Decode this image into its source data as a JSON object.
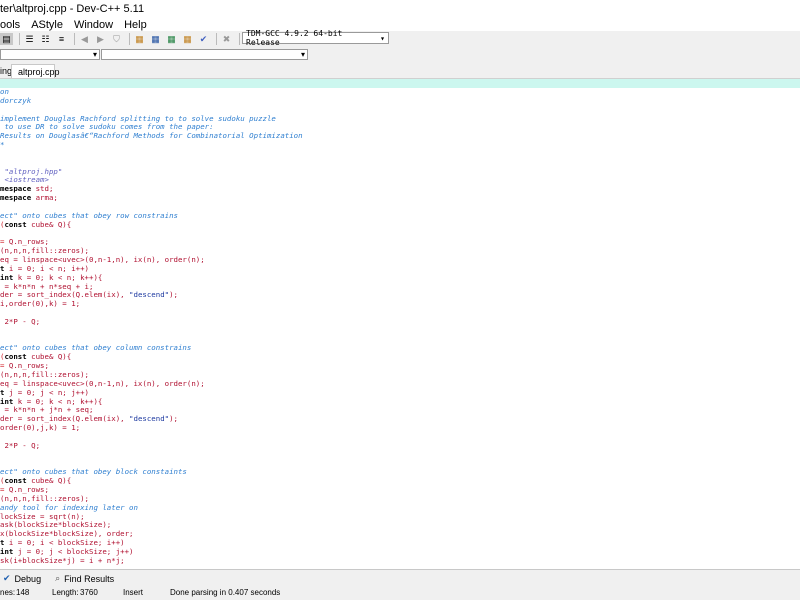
{
  "window": {
    "title": "ter\\altproj.cpp - Dev-C++ 5.11"
  },
  "menu": [
    "ools",
    "AStyle",
    "Window",
    "Help"
  ],
  "toolbar": {
    "compiler": "TDM-GCC 4.9.2 64-bit Release"
  },
  "tabs": [
    {
      "label": "ing"
    },
    {
      "label": "altproj.cpp"
    }
  ],
  "editor": {
    "lines": [
      [
        [
          "c",
          "on"
        ]
      ],
      [
        [
          "c",
          "dorczyk"
        ]
      ],
      [],
      [
        [
          "c",
          "implement Douglas Rachford splitting to to solve sudoku puzzle"
        ]
      ],
      [
        [
          "c",
          " to use DR to solve sudoku comes from the paper:"
        ]
      ],
      [
        [
          "c",
          "Results on Douglasâ€“Rachford Methods for Combinatorial Optimization"
        ]
      ],
      [
        [
          "c",
          "*"
        ]
      ],
      [],
      [],
      [
        [
          "d",
          " \"altproj.hpp\""
        ]
      ],
      [
        [
          "d",
          " <iostream>"
        ]
      ],
      [
        [
          "k",
          "mespace"
        ],
        [
          "t",
          " std;"
        ]
      ],
      [
        [
          "k",
          "mespace"
        ],
        [
          "t",
          " arma;"
        ]
      ],
      [],
      [
        [
          "c",
          "ect\" onto cubes that obey row constrains"
        ]
      ],
      [
        [
          "p",
          "("
        ],
        [
          "k",
          "const"
        ],
        [
          "t",
          " cube& Q){"
        ]
      ],
      [],
      [
        [
          "p",
          "="
        ],
        [
          "t",
          " Q.n_rows;"
        ]
      ],
      [
        [
          "t",
          "(n,n,n,fill::zeros);"
        ]
      ],
      [
        [
          "t",
          "eq = linspace<uvec>(0,n-1,n), ix(n), order(n);"
        ]
      ],
      [
        [
          "k",
          "t"
        ],
        [
          "t",
          " i = 0; i < n; i++)"
        ]
      ],
      [
        [
          "k",
          "int"
        ],
        [
          "t",
          " k = 0; k < n; k++){"
        ]
      ],
      [
        [
          "t",
          " = k*n*n + n*seq + i;"
        ]
      ],
      [
        [
          "t",
          "der = sort_index(Q.elem(ix), "
        ],
        [
          "s",
          "\"descend\""
        ],
        [
          "t",
          ");"
        ]
      ],
      [
        [
          "t",
          "i,order(0),k) = 1;"
        ]
      ],
      [],
      [
        [
          "t",
          " 2*P - Q;"
        ]
      ],
      [],
      [],
      [
        [
          "c",
          "ect\" onto cubes that obey column constrains"
        ]
      ],
      [
        [
          "p",
          "("
        ],
        [
          "k",
          "const"
        ],
        [
          "t",
          " cube& Q){"
        ]
      ],
      [
        [
          "p",
          "="
        ],
        [
          "t",
          " Q.n_rows;"
        ]
      ],
      [
        [
          "t",
          "(n,n,n,fill::zeros);"
        ]
      ],
      [
        [
          "t",
          "eq = linspace<uvec>(0,n-1,n), ix(n), order(n);"
        ]
      ],
      [
        [
          "k",
          "t"
        ],
        [
          "t",
          " j = 0; j < n; j++)"
        ]
      ],
      [
        [
          "k",
          "int"
        ],
        [
          "t",
          " k = 0; k < n; k++){"
        ]
      ],
      [
        [
          "t",
          " = k*n*n + j*n + seq;"
        ]
      ],
      [
        [
          "t",
          "der = sort_index(Q.elem(ix), "
        ],
        [
          "s",
          "\"descend\""
        ],
        [
          "t",
          ");"
        ]
      ],
      [
        [
          "t",
          "order(0),j,k) = 1;"
        ]
      ],
      [],
      [
        [
          "t",
          " 2*P - Q;"
        ]
      ],
      [],
      [],
      [
        [
          "c",
          "ect\" onto cubes that obey block constaints"
        ]
      ],
      [
        [
          "p",
          "("
        ],
        [
          "k",
          "const"
        ],
        [
          "t",
          " cube& Q){"
        ]
      ],
      [
        [
          "p",
          "="
        ],
        [
          "t",
          " Q.n_rows;"
        ]
      ],
      [
        [
          "t",
          "(n,n,n,fill::zeros);"
        ]
      ],
      [
        [
          "c",
          "andy tool for indexing later on"
        ]
      ],
      [
        [
          "t",
          "lockSize = sqrt(n);"
        ]
      ],
      [
        [
          "t",
          "ask(blockSize*blockSize);"
        ]
      ],
      [
        [
          "t",
          "x(blockSize*blockSize), order;"
        ]
      ],
      [
        [
          "k",
          "t"
        ],
        [
          "t",
          " i = 0; i < blockSize; i++)"
        ]
      ],
      [
        [
          "k",
          "int"
        ],
        [
          "t",
          " j = 0; j < blockSize; j++)"
        ]
      ],
      [
        [
          "t",
          "sk(i+blockSize*j) = i + n*j;"
        ]
      ]
    ]
  },
  "bottom": {
    "debug": "Debug",
    "find": "Find Results"
  },
  "status": {
    "lines_label": "nes:",
    "lines": "148",
    "length_label": "Length:",
    "length": "3760",
    "mode": "Insert",
    "parse": "Done parsing in 0.407 seconds"
  }
}
